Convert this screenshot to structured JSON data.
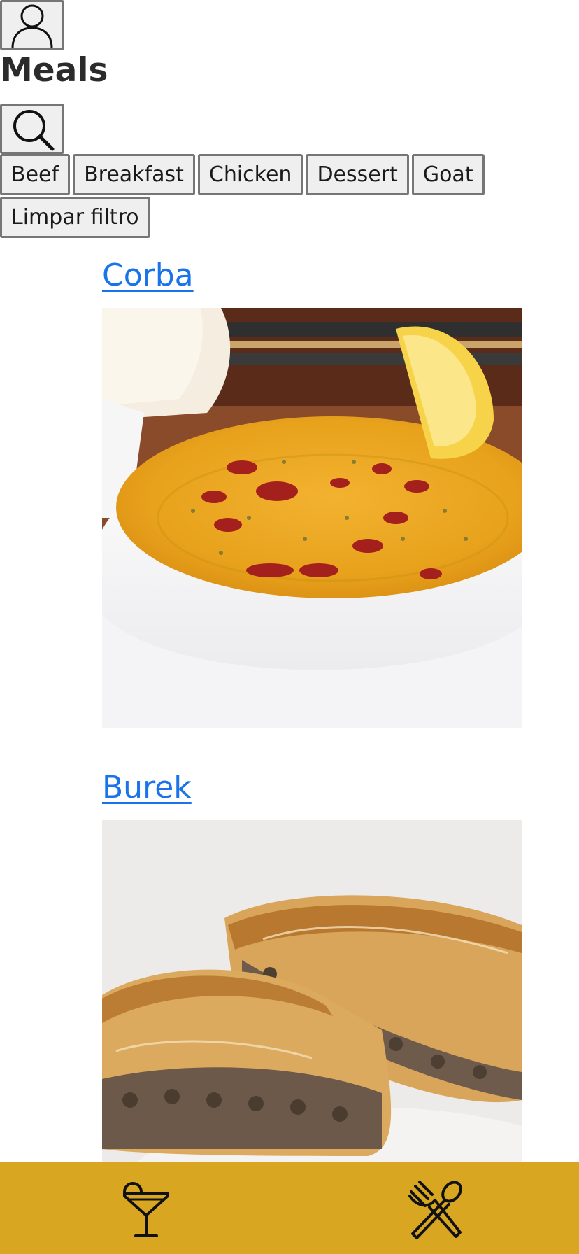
{
  "header": {
    "title": "Meals",
    "profile_icon": "profile-icon",
    "search_icon": "search-icon"
  },
  "filters": {
    "categories": [
      "Beef",
      "Breakfast",
      "Chicken",
      "Dessert",
      "Goat"
    ],
    "clear_label": "Limpar filtro"
  },
  "meals": [
    {
      "name": "Corba",
      "image_icon": "corba-photo"
    },
    {
      "name": "Burek",
      "image_icon": "burek-photo"
    }
  ],
  "footer": {
    "drinks_icon": "cocktail-icon",
    "meals_icon": "fork-spoon-icon"
  },
  "colors": {
    "footer_bg": "#d9a621",
    "link": "#1a73e8",
    "button_bg": "#efefef",
    "button_border": "#767676"
  }
}
